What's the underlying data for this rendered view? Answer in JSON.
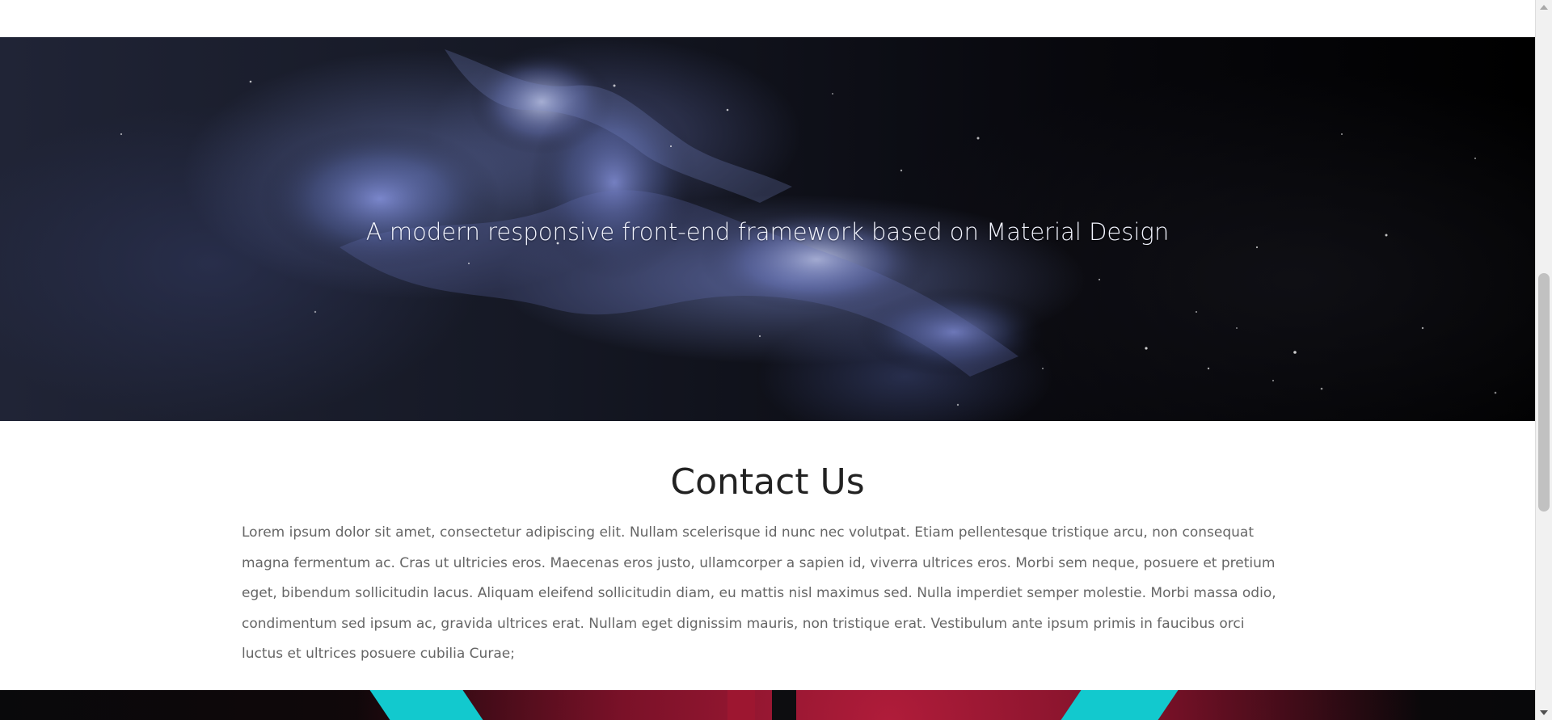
{
  "hero": {
    "tagline": "A modern responsive front-end framework based on Material Design"
  },
  "contact": {
    "title": "Contact Us",
    "body": "Lorem ipsum dolor sit amet, consectetur adipiscing elit. Nullam scelerisque id nunc nec volutpat. Etiam pellentesque tristique arcu, non consequat magna fermentum ac. Cras ut ultricies eros. Maecenas eros justo, ullamcorper a sapien id, viverra ultrices eros. Morbi sem neque, posuere et pretium eget, bibendum sollicitudin lacus. Aliquam eleifend sollicitudin diam, eu mattis nisl maximus sed. Nulla imperdiet semper molestie. Morbi massa odio, condimentum sed ipsum ac, gravida ultrices erat. Nullam eget dignissim mauris, non tristique erat. Vestibulum ante ipsum primis in faucibus orci luctus et ultrices posuere cubilia Curae;"
  },
  "colors": {
    "page_background": "#ffffff",
    "heading": "#222222",
    "paragraph": "#666666",
    "hero_text": "#f3f5ff",
    "scrollbar_track": "#f1f1f1",
    "scrollbar_thumb": "#c1c1c1",
    "teal_accent": "#12c9ce",
    "red_accent": "#b01c3a"
  },
  "icons": {
    "scroll_up": "scroll-up-arrow-icon",
    "scroll_down": "scroll-down-arrow-icon"
  }
}
